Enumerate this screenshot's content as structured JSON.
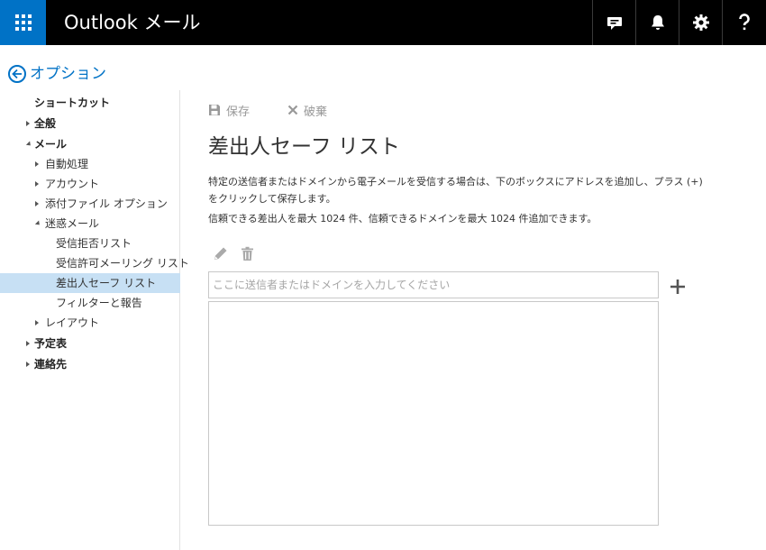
{
  "header": {
    "app_title": "Outlook メール",
    "icons": [
      "app-launcher-icon",
      "chat-icon",
      "bell-icon",
      "gear-icon",
      "help-icon"
    ],
    "accent_color": "#0072c6"
  },
  "options": {
    "title": "オプション"
  },
  "nav": {
    "items": [
      {
        "label": "ショートカット",
        "level": 0,
        "bold": true,
        "toggle": "none"
      },
      {
        "label": "全般",
        "level": 0,
        "bold": true,
        "toggle": "collapsed"
      },
      {
        "label": "メール",
        "level": 0,
        "bold": true,
        "toggle": "expanded"
      },
      {
        "label": "自動処理",
        "level": 1,
        "bold": false,
        "toggle": "collapsed"
      },
      {
        "label": "アカウント",
        "level": 1,
        "bold": false,
        "toggle": "collapsed"
      },
      {
        "label": "添付ファイル オプション",
        "level": 1,
        "bold": false,
        "toggle": "collapsed"
      },
      {
        "label": "迷惑メール",
        "level": 1,
        "bold": false,
        "toggle": "expanded"
      },
      {
        "label": "受信拒否リスト",
        "level": 2,
        "bold": false,
        "toggle": "none"
      },
      {
        "label": "受信許可メーリング リスト",
        "level": 2,
        "bold": false,
        "toggle": "none"
      },
      {
        "label": "差出人セーフ リスト",
        "level": 2,
        "bold": false,
        "toggle": "none",
        "selected": true
      },
      {
        "label": "フィルターと報告",
        "level": 2,
        "bold": false,
        "toggle": "none"
      },
      {
        "label": "レイアウト",
        "level": 1,
        "bold": false,
        "toggle": "collapsed"
      },
      {
        "label": "予定表",
        "level": 0,
        "bold": true,
        "toggle": "collapsed"
      },
      {
        "label": "連絡先",
        "level": 0,
        "bold": true,
        "toggle": "collapsed"
      }
    ]
  },
  "toolbar": {
    "save_label": "保存",
    "discard_label": "破棄"
  },
  "main": {
    "title": "差出人セーフ リスト",
    "desc_line1": "特定の送信者またはドメインから電子メールを受信する場合は、下のボックスにアドレスを追加し、プラス (+)",
    "desc_line2": "をクリックして保存します。",
    "desc_line3": "信頼できる差出人を最大 1024 件、信頼できるドメインを最大 1024 件追加できます。",
    "input_placeholder": "ここに送信者またはドメインを入力してください",
    "input_value": "",
    "list_items": []
  }
}
